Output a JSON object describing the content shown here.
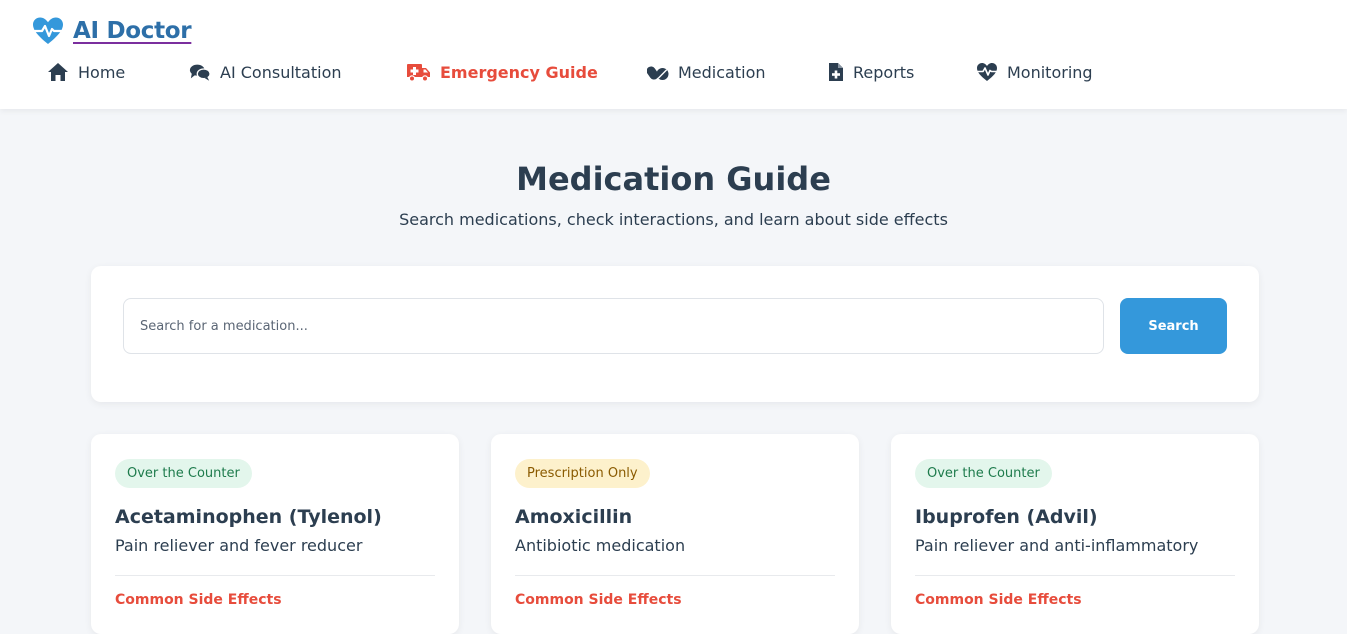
{
  "app": {
    "brand": "AI Doctor",
    "accent_color": "#3498db",
    "active_color": "#e74c3c"
  },
  "nav": {
    "items": [
      {
        "label": "Home",
        "icon": "home-icon"
      },
      {
        "label": "AI Consultation",
        "icon": "chat-icon"
      },
      {
        "label": "Emergency Guide",
        "icon": "ambulance-icon",
        "active": true
      },
      {
        "label": "Medication",
        "icon": "pills-icon"
      },
      {
        "label": "Reports",
        "icon": "file-medical-icon"
      },
      {
        "label": "Monitoring",
        "icon": "heartbeat-icon"
      }
    ]
  },
  "page": {
    "title": "Medication Guide",
    "subtitle": "Search medications, check interactions, and learn about side effects"
  },
  "search": {
    "placeholder": "Search for a medication...",
    "value": "",
    "button_label": "Search"
  },
  "medications": [
    {
      "badge": "Over the Counter",
      "badge_type": "otc",
      "name": "Acetaminophen (Tylenol)",
      "description": "Pain reliever and fever reducer",
      "section": "Common Side Effects"
    },
    {
      "badge": "Prescription Only",
      "badge_type": "rx",
      "name": "Amoxicillin",
      "description": "Antibiotic medication",
      "section": "Common Side Effects"
    },
    {
      "badge": "Over the Counter",
      "badge_type": "otc",
      "name": "Ibuprofen (Advil)",
      "description": "Pain reliever and anti-inflammatory",
      "section": "Common Side Effects"
    }
  ]
}
